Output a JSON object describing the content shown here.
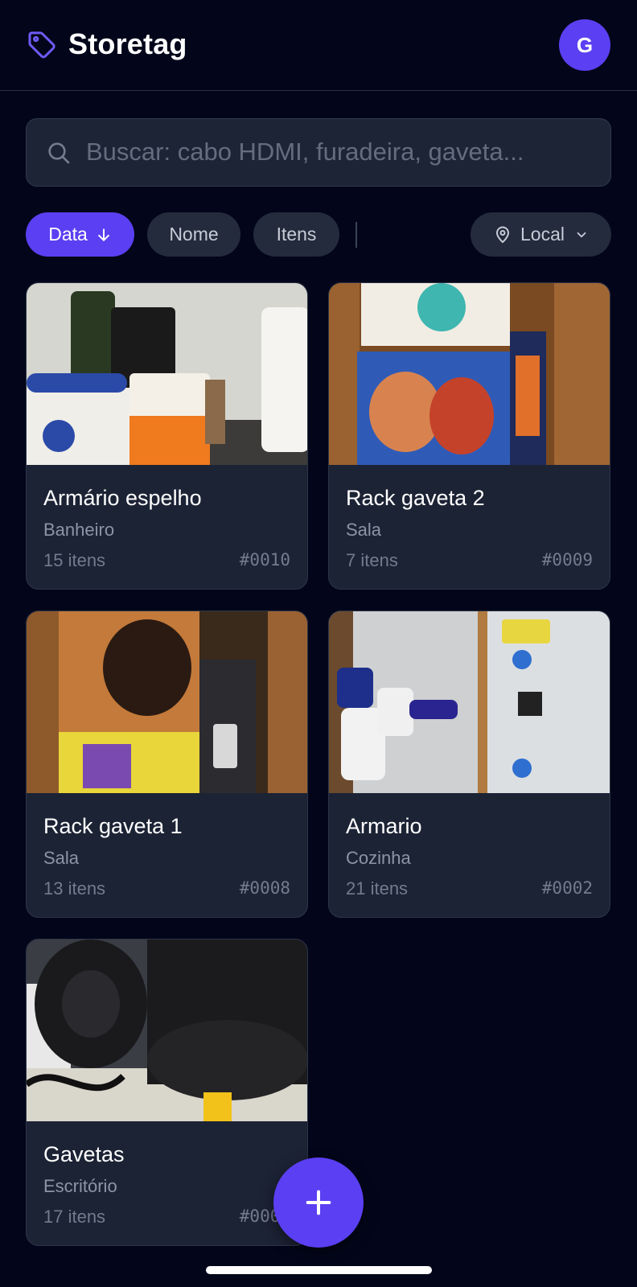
{
  "app": {
    "title": "Storetag",
    "avatar_initial": "G",
    "accent_color": "#5b3ff2"
  },
  "search": {
    "placeholder": "Buscar: cabo HDMI, furadeira, gaveta...",
    "value": ""
  },
  "filters": {
    "sort_options": [
      {
        "label": "Data",
        "active": true,
        "icon": "arrow-down-icon"
      },
      {
        "label": "Nome",
        "active": false
      },
      {
        "label": "Itens",
        "active": false
      }
    ],
    "location": {
      "label": "Local",
      "icon": "map-pin-icon"
    }
  },
  "cards": [
    {
      "title": "Armário espelho",
      "location": "Banheiro",
      "count": "15 itens",
      "code": "#0010"
    },
    {
      "title": "Rack gaveta 2",
      "location": "Sala",
      "count": "7 itens",
      "code": "#0009"
    },
    {
      "title": "Rack gaveta 1",
      "location": "Sala",
      "count": "13 itens",
      "code": "#0008"
    },
    {
      "title": "Armario",
      "location": "Cozinha",
      "count": "21 itens",
      "code": "#0002"
    },
    {
      "title": "Gavetas",
      "location": "Escritório",
      "count": "17 itens",
      "code": "#0001"
    }
  ],
  "fab": {
    "icon": "plus-icon"
  }
}
